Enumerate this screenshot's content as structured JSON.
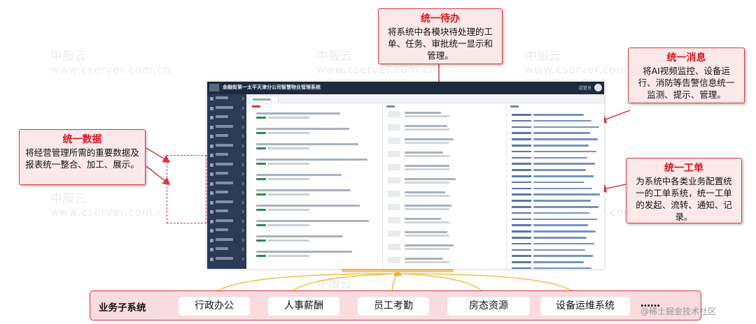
{
  "watermark": {
    "cn": "中服云",
    "en": "www.cserver.com.cn"
  },
  "callouts": {
    "todo": {
      "title": "统一待办",
      "body": "将系统中各模块待处理的工单、任务、审批统一显示和管理。"
    },
    "message": {
      "title": "统一消息",
      "body": "将AI视频监控、设备运行、消防等告警信息统一监测、提示、管理。"
    },
    "data": {
      "title": "统一数据",
      "body": "将经营管理所需的重要数据及报表统一整合、加工、展示。"
    },
    "workorder": {
      "title": "统一工单",
      "body": "为系统中各类业务配置统一的工单系统，统一工单的发起、流转、通知、记录。"
    }
  },
  "screenshot": {
    "window_title": "金融街第一太平天津分公司智慧物业管理系统",
    "user": "超管员"
  },
  "bottom_bar": {
    "label": "业务子系统",
    "items": [
      "行政办公",
      "人事薪酬",
      "员工考勤",
      "房态资源",
      "设备运维系统"
    ],
    "more": "……"
  },
  "credit": "@稀土掘金技术社区",
  "colors": {
    "accent_red": "#d9363e",
    "callout_fill": "#fbe9ea",
    "bar_fill": "#f9dcde",
    "arrow_yellow": "#f2b233",
    "nav_dark": "#1d2a3f"
  }
}
